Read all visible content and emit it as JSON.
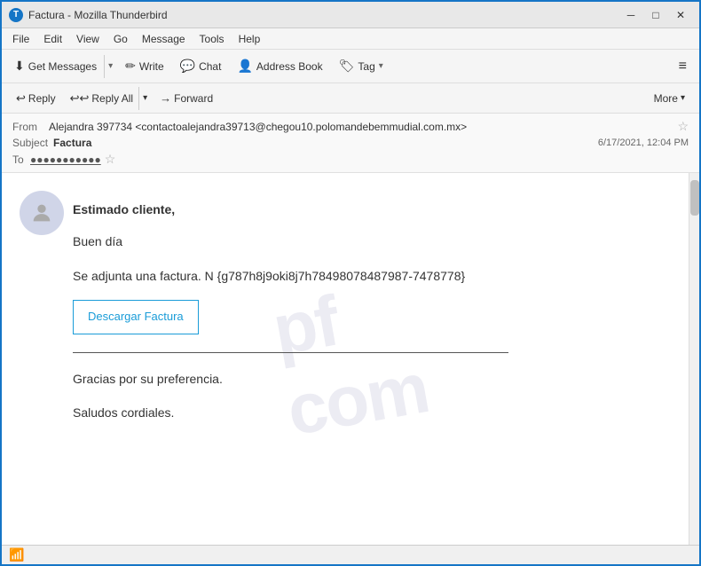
{
  "titleBar": {
    "icon": "T",
    "title": "Factura - Mozilla Thunderbird",
    "controls": {
      "minimize": "─",
      "maximize": "□",
      "close": "✕"
    }
  },
  "menuBar": {
    "items": [
      "File",
      "Edit",
      "View",
      "Go",
      "Message",
      "Tools",
      "Help"
    ]
  },
  "toolbar": {
    "getMessages": "Get Messages",
    "write": "Write",
    "chat": "Chat",
    "addressBook": "Address Book",
    "tag": "Tag"
  },
  "actionBar": {
    "reply": "Reply",
    "replyAll": "Reply All",
    "forward": "Forward",
    "more": "More"
  },
  "emailMeta": {
    "fromLabel": "From",
    "fromValue": "Alejandra 397734 <contactoalejandra39713@chegou10.polomandebemmudial.com.mx>",
    "subjectLabel": "Subject",
    "subjectValue": "Factura",
    "date": "6/17/2021, 12:04 PM",
    "toLabel": "To",
    "toValue": "●●●●●●●●●●●"
  },
  "emailBody": {
    "greeting": "Estimado cliente,",
    "line1": "Buen día",
    "line2": "Se adjunta una factura. N {g787h8j9oki8j7h78498078487987-7478778}",
    "downloadBtn": "Descargar Factura",
    "closing1": "Gracias por su preferencia.",
    "closing2": "Saludos cordiales."
  },
  "statusBar": {
    "icon": "📶"
  }
}
